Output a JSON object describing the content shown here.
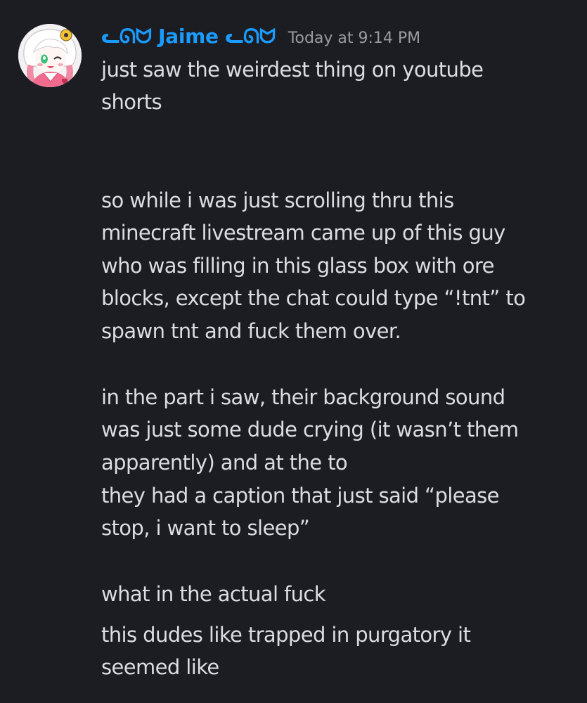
{
  "message": {
    "author": "ᓚᘏᗢ Jaime ᓚᘏᗢ",
    "timestamp": "Today at 9:14 PM",
    "avatar_icon": "anime-character-avatar",
    "username_color": "#1a9cff",
    "background_color": "#1c1d22",
    "text_color": "#dbdee1",
    "lines": [
      "just saw the weirdest thing on youtube",
      "shorts",
      "so while i was just scrolling thru this",
      "minecraft livestream came up of this guy",
      "who was filling in this glass box with ore",
      "blocks, except the chat could type “!tnt” to",
      "spawn tnt and fuck them over.",
      "in the part i saw, their background sound",
      "was just some dude crying (it wasn’t them",
      "apparently) and at the to",
      "they had a caption that just said “please",
      "stop, i want to sleep”",
      "what in the actual fuck",
      "this dudes like trapped in purgatory it",
      "seemed like"
    ]
  }
}
